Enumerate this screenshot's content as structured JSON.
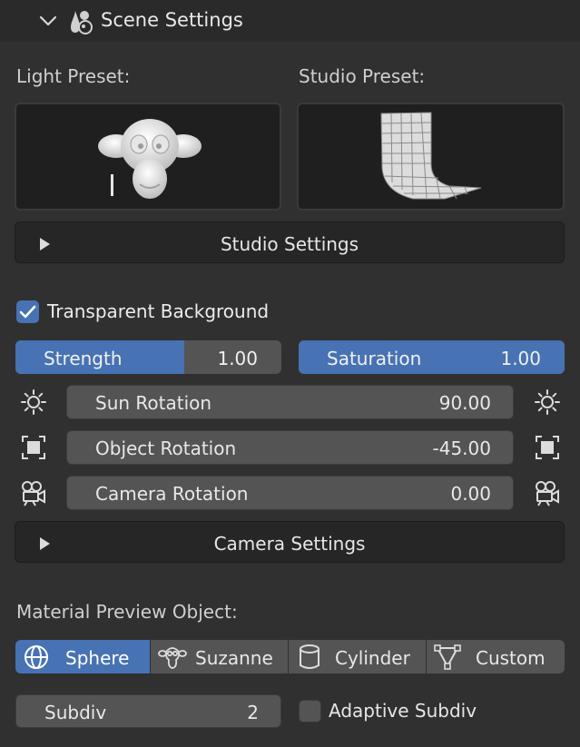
{
  "panel": {
    "title": "Scene Settings",
    "icons": {
      "collapse": "chevron-down-icon",
      "section": "scene-settings-icon"
    }
  },
  "presets": {
    "light_label": "Light Preset:",
    "studio_label": "Studio Preset:",
    "light_thumb_icon": "monkey-head-icon",
    "studio_thumb_icon": "studio-backdrop-icon"
  },
  "studio_settings": {
    "label": "Studio Settings",
    "expanded": false
  },
  "transparent_background": {
    "label": "Transparent Background",
    "checked": true
  },
  "strength": {
    "label": "Strength",
    "value": "1.00"
  },
  "saturation": {
    "label": "Saturation",
    "value": "1.00"
  },
  "rotations": [
    {
      "label": "Sun Rotation",
      "value": "90.00",
      "icon": "sun-icon"
    },
    {
      "label": "Object Rotation",
      "value": "-45.00",
      "icon": "object-icon"
    },
    {
      "label": "Camera Rotation",
      "value": "0.00",
      "icon": "camera-icon"
    }
  ],
  "camera_settings": {
    "label": "Camera Settings",
    "expanded": false
  },
  "material_preview": {
    "label": "Material Preview Object:",
    "options": [
      {
        "label": "Sphere",
        "icon": "sphere-icon",
        "selected": true
      },
      {
        "label": "Suzanne",
        "icon": "suzanne-icon",
        "selected": false
      },
      {
        "label": "Cylinder",
        "icon": "cylinder-icon",
        "selected": false
      },
      {
        "label": "Custom",
        "icon": "custom-mesh-icon",
        "selected": false
      }
    ]
  },
  "subdiv": {
    "label": "Subdiv",
    "value": "2"
  },
  "adaptive_subdiv": {
    "label": "Adaptive Subdiv",
    "checked": false
  },
  "colors": {
    "accent": "#4772b3",
    "panel_bg": "#303030",
    "header_bg": "#2a2a2a",
    "field_bg": "#545454",
    "thumb_bg": "#1f1f1f"
  }
}
